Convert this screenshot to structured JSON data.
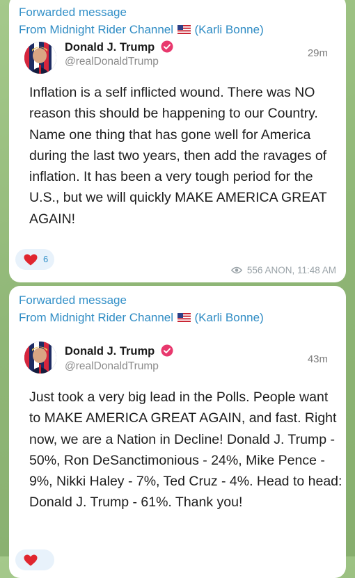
{
  "messages": [
    {
      "forward_title": "Forwarded message",
      "forward_from_prefix": "From Midnight Rider Channel",
      "forward_from_suffix": "(Karli Bonne)",
      "author": "Donald J. Trump",
      "handle": "@realDonaldTrump",
      "post_time": "29m",
      "text": "Inflation is a self inflicted wound. There was NO reason this should be happening to our Country. Name one thing that has gone well for America during the last two years, then add the ravages of inflation. It has been a very tough period for the U.S., but we will quickly MAKE AMERICA GREAT AGAIN!",
      "reaction_count": "6",
      "views": "556",
      "signature": "ANON, 11:48 AM"
    },
    {
      "forward_title": "Forwarded message",
      "forward_from_prefix": "From Midnight Rider Channel",
      "forward_from_suffix": "(Karli Bonne)",
      "author": "Donald J. Trump",
      "handle": "@realDonaldTrump",
      "post_time": "43m",
      "text": "Just took a very big lead in the Polls. People want to MAKE AMERICA GREAT AGAIN, and fast. Right now, we are a Nation in Decline! Donald J. Trump - 50%, Ron DeSanctimonious - 24%, Mike Pence - 9%, Nikki Haley - 7%, Ted Cruz - 4%. Head to head: Donald J. Trump - 61%. Thank you!"
    }
  ],
  "icons": {
    "flag": "us-flag-icon",
    "verified": "verified-badge-icon",
    "reaction": "red-heart-icon",
    "views": "eye-icon"
  },
  "colors": {
    "link_blue": "#3390c8",
    "verified_pink": "#e8386d",
    "heart_red": "#e0262f",
    "wallpaper_green": "#93b97b"
  }
}
